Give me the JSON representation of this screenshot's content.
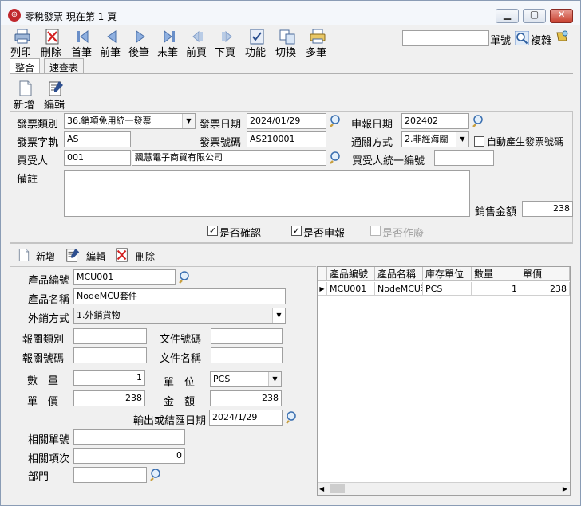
{
  "window": {
    "title": "零稅發票  現在第 1 頁"
  },
  "toolbar": {
    "print": "列印",
    "delete": "刪除",
    "first": "首筆",
    "prev": "前筆",
    "next": "後筆",
    "last": "末筆",
    "prev_page": "前頁",
    "next_page": "下頁",
    "function": "功能",
    "switch": "切換",
    "multi": "多筆",
    "search_value": "",
    "doc_no_label": "單號",
    "copy_label": "複雜"
  },
  "tabs": [
    "整合",
    "速查表"
  ],
  "header_actions": {
    "new": "新增",
    "edit": "編輯"
  },
  "invoice": {
    "type_label": "發票類別",
    "type_value": "36.銷項免用統一發票",
    "date_label": "發票日期",
    "date_value": "2024/01/29",
    "report_date_label": "申報日期",
    "report_date_value": "202402",
    "track_label": "發票字軌",
    "track_value": "AS",
    "number_label": "發票號碼",
    "number_value": "AS210001",
    "customs_label": "通關方式",
    "customs_value": "2.非經海關",
    "auto_label": "自動產生發票號碼",
    "buyer_label": "買受人",
    "buyer_code": "001",
    "buyer_name": "飄慧電子商貿有限公司",
    "buyer_tax_label": "買受人統一編號",
    "buyer_tax_value": "",
    "remark_label": "備註",
    "remark_value": "",
    "sales_label": "銷售金額",
    "sales_value": "238",
    "confirmed_label": "是否確認",
    "confirmed": true,
    "reported_label": "是否申報",
    "reported": true,
    "voided_label": "是否作廢",
    "voided": false
  },
  "detail_actions": {
    "new": "新增",
    "edit": "編輯",
    "delete": "刪除"
  },
  "detail": {
    "product_code_label": "產品編號",
    "product_code": "MCU001",
    "product_name_label": "產品名稱",
    "product_name": "NodeMCU套件",
    "export_label": "外銷方式",
    "export_value": "1.外銷貨物",
    "customs_type_label": "報關類別",
    "customs_type": "",
    "doc_no_label": "文件號碼",
    "doc_no": "",
    "customs_no_label": "報關號碼",
    "customs_no": "",
    "doc_name_label": "文件名稱",
    "doc_name": "",
    "qty_label": "數　量",
    "qty": "1",
    "unit_label": "單　位",
    "unit": "PCS",
    "price_label": "單　價",
    "price": "238",
    "amount_label": "金　額",
    "amount": "238",
    "export_date_label": "輸出或結匯日期",
    "export_date": "2024/1/29",
    "related_no_label": "相關單號",
    "related_no": "",
    "related_item_label": "相關項次",
    "related_item": "0",
    "dept_label": "部門",
    "dept": ""
  },
  "grid": {
    "columns": [
      "產品編號",
      "產品名稱",
      "庫存單位",
      "數量",
      "單價"
    ],
    "rows": [
      {
        "code": "MCU001",
        "name": "NodeMCU套",
        "unit": "PCS",
        "qty": "1",
        "price": "238"
      }
    ]
  }
}
